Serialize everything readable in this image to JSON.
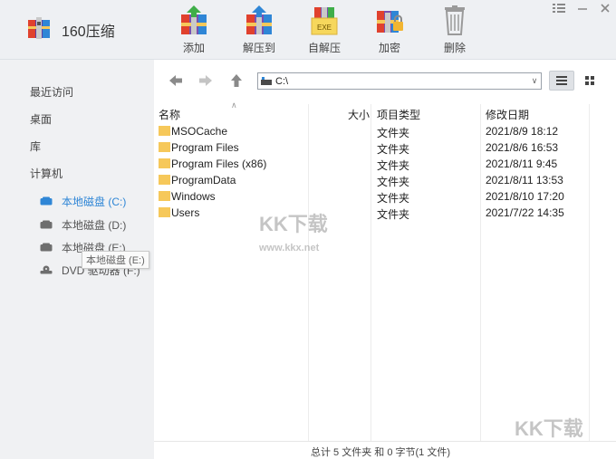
{
  "app": {
    "title": "160压缩"
  },
  "toolbar": {
    "add": "添加",
    "extract_to": "解压到",
    "self_extract": "自解压",
    "self_extract_badge": "EXE",
    "encrypt": "加密",
    "delete": "删除"
  },
  "sidebar": {
    "items": [
      "最近访问",
      "桌面",
      "库",
      "计算机"
    ],
    "drives": [
      {
        "label": "本地磁盘 (C:)",
        "active": true
      },
      {
        "label": "本地磁盘 (D:)",
        "active": false
      },
      {
        "label": "本地磁盘 (E:)",
        "active": false
      },
      {
        "label": "DVD 驱动器 (F:)",
        "active": false
      }
    ],
    "tooltip": "本地磁盘 (E:)"
  },
  "address": {
    "path": "C:\\"
  },
  "columns": {
    "name": "名称",
    "size": "大小",
    "type": "项目类型",
    "modified": "修改日期"
  },
  "files": [
    {
      "name": "MSOCache",
      "type": "文件夹",
      "modified": "2021/8/9 18:12"
    },
    {
      "name": "Program Files",
      "type": "文件夹",
      "modified": "2021/8/6 16:53"
    },
    {
      "name": "Program Files (x86)",
      "type": "文件夹",
      "modified": "2021/8/11 9:45"
    },
    {
      "name": "ProgramData",
      "type": "文件夹",
      "modified": "2021/8/11 13:53"
    },
    {
      "name": "Windows",
      "type": "文件夹",
      "modified": "2021/8/10 17:20"
    },
    {
      "name": "Users",
      "type": "文件夹",
      "modified": "2021/7/22 14:35"
    }
  ],
  "status": {
    "text": "总计 5 文件夹 和 0 字节(1 文件)"
  },
  "watermark": {
    "logo": "KK下载",
    "url": "www.kkx.net"
  },
  "colors": {
    "accent": "#2f86d6",
    "folder": "#f6c85a",
    "sidebar_bg": "#f0f1f3",
    "topbar_bg": "#eef0f3"
  }
}
